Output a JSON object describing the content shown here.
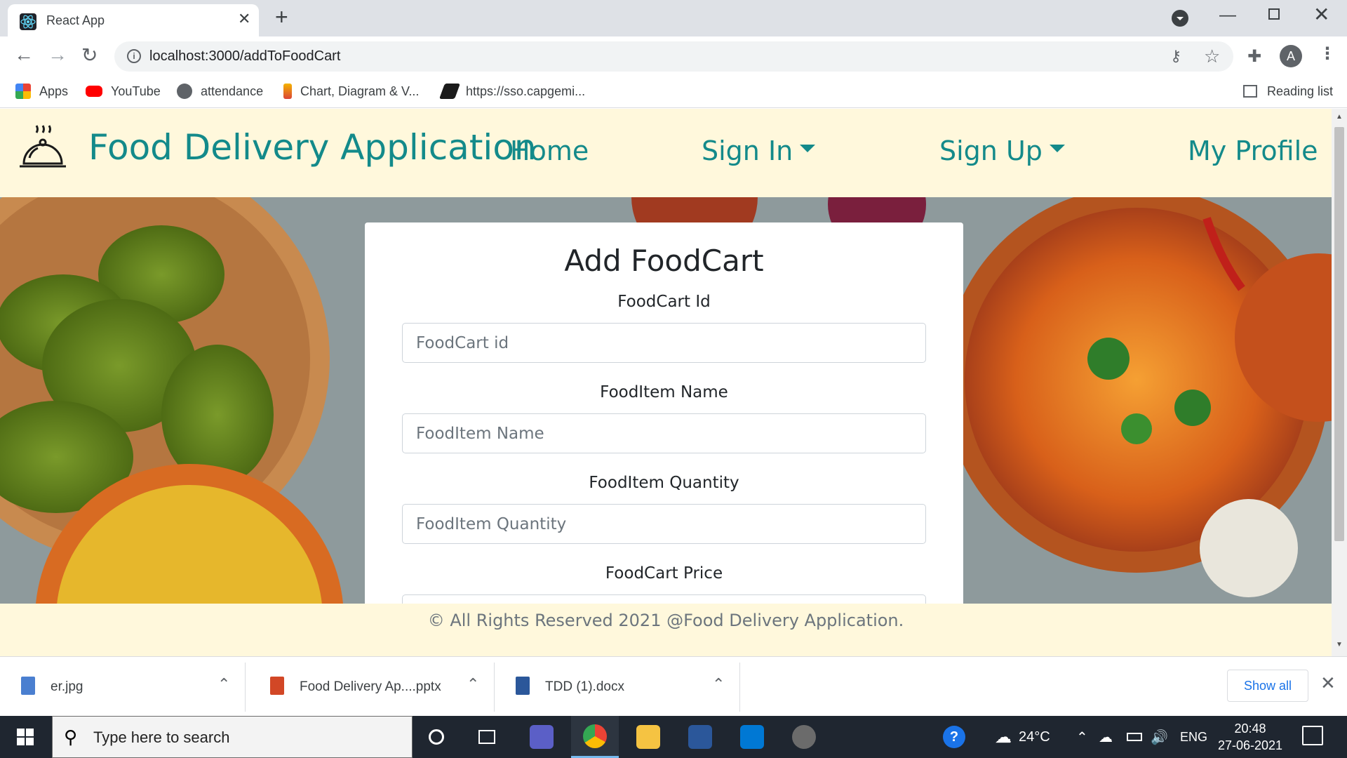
{
  "browser": {
    "tab_title": "React App",
    "tab_close": "✕",
    "new_tab": "+",
    "url": "localhost:3000/addToFoodCart",
    "profile_initial": "A",
    "bookmarks": [
      {
        "label": "Apps",
        "icon": "apps-grid-icon"
      },
      {
        "label": "YouTube",
        "icon": "youtube-icon"
      },
      {
        "label": "attendance",
        "icon": "globe-icon"
      },
      {
        "label": "Chart, Diagram & V...",
        "icon": "chart-diagram-icon"
      },
      {
        "label": "https://sso.capgemi...",
        "icon": "capgemini-icon"
      }
    ],
    "reading_list": "Reading list"
  },
  "app": {
    "brand": "Food Delivery Application",
    "nav": {
      "home": "Home",
      "sign_in": "Sign In",
      "sign_up": "Sign Up",
      "my_profile": "My Profile"
    },
    "accent_color": "#138a8a",
    "header_bg": "#fff8dc",
    "footer": "© All Rights Reserved 2021 @Food Delivery Application."
  },
  "form": {
    "title": "Add FoodCart",
    "fields": [
      {
        "label": "FoodCart Id",
        "placeholder": "FoodCart id",
        "value": ""
      },
      {
        "label": "FoodItem Name",
        "placeholder": "FoodItem Name",
        "value": ""
      },
      {
        "label": "FoodItem Quantity",
        "placeholder": "FoodItem Quantity",
        "value": ""
      },
      {
        "label": "FoodCart Price",
        "placeholder": "",
        "value": ""
      }
    ]
  },
  "downloads": {
    "items": [
      {
        "name": "er.jpg",
        "type": "image-file-icon"
      },
      {
        "name": "Food Delivery Ap....pptx",
        "type": "powerpoint-file-icon"
      },
      {
        "name": "TDD (1).docx",
        "type": "word-file-icon"
      }
    ],
    "show_all": "Show all"
  },
  "taskbar": {
    "search_placeholder": "Type here to search",
    "weather": "24°C",
    "language": "ENG",
    "time": "20:48",
    "date": "27-06-2021"
  }
}
